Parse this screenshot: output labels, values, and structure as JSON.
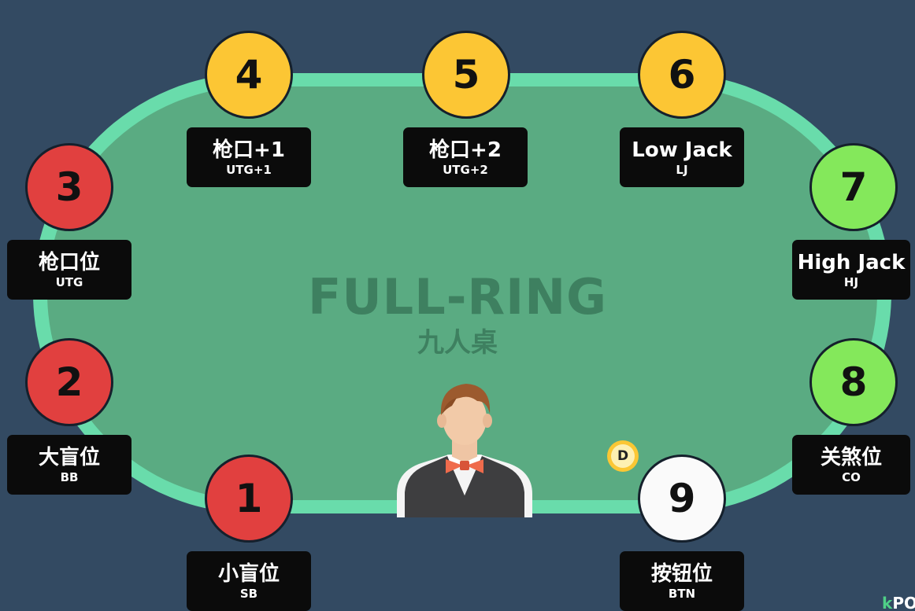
{
  "title": "FULL-RING",
  "subtitle": "九人桌",
  "dealer_button_label": "D",
  "seats": [
    {
      "number": "1",
      "name": "小盲位",
      "abbr": "SB",
      "color": "#e1403f"
    },
    {
      "number": "2",
      "name": "大盲位",
      "abbr": "BB",
      "color": "#e1403f"
    },
    {
      "number": "3",
      "name": "枪口位",
      "abbr": "UTG",
      "color": "#e1403f"
    },
    {
      "number": "4",
      "name": "枪口+1",
      "abbr": "UTG+1",
      "color": "#fcc634"
    },
    {
      "number": "5",
      "name": "枪口+2",
      "abbr": "UTG+2",
      "color": "#fcc634"
    },
    {
      "number": "6",
      "name": "Low Jack",
      "abbr": "LJ",
      "color": "#fcc634"
    },
    {
      "number": "7",
      "name": "High Jack",
      "abbr": "HJ",
      "color": "#84e85b"
    },
    {
      "number": "8",
      "name": "关煞位",
      "abbr": "CO",
      "color": "#84e85b"
    },
    {
      "number": "9",
      "name": "按钮位",
      "abbr": "BTN",
      "color": "#fafafa"
    }
  ],
  "brand": {
    "prefix": "k",
    "text": "PO"
  },
  "colors": {
    "background": "#334a62",
    "table_rail": "#69dcab",
    "table_felt": "#5aab82",
    "label_bg": "#0b0b0b"
  }
}
